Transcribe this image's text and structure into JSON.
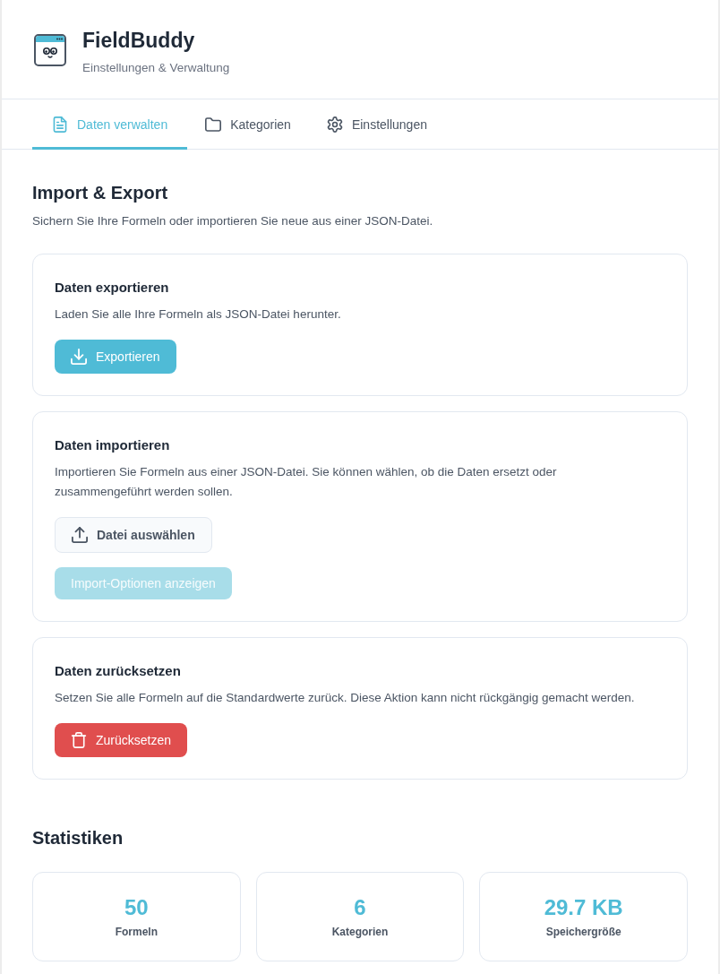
{
  "app": {
    "title": "FieldBuddy",
    "subtitle": "Einstellungen & Verwaltung"
  },
  "tabs": [
    {
      "label": "Daten verwalten",
      "selected": true
    },
    {
      "label": "Kategorien",
      "selected": false
    },
    {
      "label": "Einstellungen",
      "selected": false
    }
  ],
  "section": {
    "title": "Import & Export",
    "description": "Sichern Sie Ihre Formeln oder importieren Sie neue aus einer JSON-Datei."
  },
  "cards": [
    {
      "title": "Daten exportieren",
      "description": "Laden Sie alle Ihre Formeln als JSON-Datei herunter.",
      "buttons": [
        {
          "label": "Exportieren",
          "kind": "primary",
          "disabled": false
        }
      ]
    },
    {
      "title": "Daten importieren",
      "description": "Importieren Sie Formeln aus einer JSON-Datei. Sie können wählen, ob die Daten ersetzt oder zusammengeführt werden sollen.",
      "buttons": [
        {
          "label": "Datei auswählen",
          "kind": "secondary",
          "disabled": false
        },
        {
          "label": "Import-Optionen anzeigen",
          "kind": "primary",
          "disabled": true
        }
      ]
    },
    {
      "title": "Daten zurücksetzen",
      "description": "Setzen Sie alle Formeln auf die Standardwerte zurück. Diese Aktion kann nicht rückgängig gemacht werden.",
      "buttons": [
        {
          "label": "Zurücksetzen",
          "kind": "danger",
          "disabled": false
        }
      ]
    }
  ],
  "statistics": {
    "title": "Statistiken",
    "items": [
      {
        "value": "50",
        "label": "Formeln"
      },
      {
        "value": "6",
        "label": "Kategorien"
      },
      {
        "value": "29.7 KB",
        "label": "Speichergröße"
      }
    ]
  }
}
